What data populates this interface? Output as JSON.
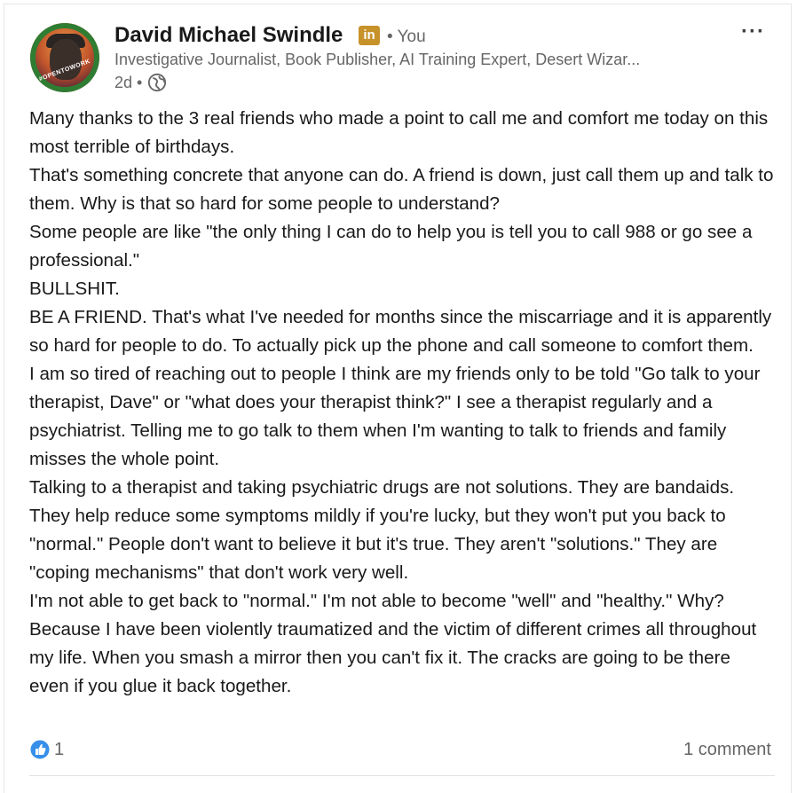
{
  "post": {
    "author_name": "David Michael Swindle",
    "badge_label": "in",
    "relation": "• You",
    "headline": "Investigative Journalist, Book Publisher, AI Training Expert, Desert Wizar...",
    "time_ago": "2d •",
    "avatar_ring_text": "#OPENTOWORK",
    "more_menu_label": "···",
    "paragraphs": [
      "Many thanks to the 3 real friends who made a point to call me and comfort me today on this most terrible of birthdays.",
      "That's something concrete that anyone can do. A friend is down, just call them up and talk to them. Why is that so hard for some people to understand?",
      "Some people are like \"the only thing I can do to help you is tell you to call 988 or go see a professional.\"",
      "BULLSHIT.",
      "BE A FRIEND. That's what I've needed for months since the miscarriage and it is apparently so hard for people to do. To actually pick up the phone and call someone to comfort them.",
      "I am so tired of reaching out to people I think are my friends only to be told \"Go talk to your therapist, Dave\" or \"what does your therapist think?\" I see a therapist regularly and a psychiatrist. Telling me to go talk to them when I'm wanting to talk to friends and family misses the whole point.",
      "Talking to a therapist and taking psychiatric drugs are not solutions. They are bandaids. They help reduce some symptoms mildly if you're lucky, but they won't put you back to \"normal.\" People don't want to believe it but it's true. They aren't \"solutions.\" They are \"coping mechanisms\" that don't work very well.",
      "I'm not able to get back to \"normal.\" I'm not able to become \"well\" and \"healthy.\" Why? Because I have been violently traumatized and the victim of different crimes all throughout my life. When you smash a mirror then you can't fix it. The cracks are going to be there even if you glue it back together."
    ],
    "reaction_count": "1",
    "comment_count": "1 comment"
  },
  "icons": {
    "globe": "globe-icon",
    "like": "like-icon",
    "more": "more-options-icon"
  },
  "colors": {
    "badge": "#c7922a",
    "ring": "#2e7d32",
    "like_blue": "#378fe9",
    "muted_text": "#666666"
  }
}
